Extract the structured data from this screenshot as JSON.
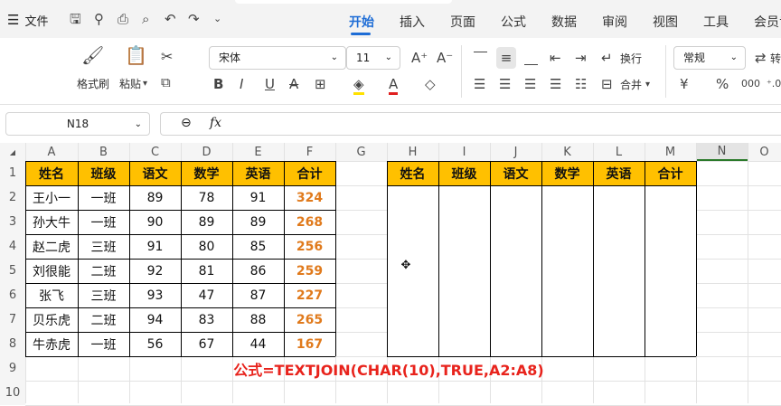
{
  "menu": {
    "file_label": "文件"
  },
  "tabs": [
    "开始",
    "插入",
    "页面",
    "公式",
    "数据",
    "审阅",
    "视图",
    "工具",
    "会员专"
  ],
  "ribbon": {
    "format_painter": "格式刷",
    "paste": "粘贴",
    "font_name": "宋体",
    "font_size": "11",
    "wrap_text": "换行",
    "merge": "合并",
    "number_format": "常规",
    "convert_label": "转"
  },
  "formula_bar": {
    "name_box": "N18",
    "fx": "fx",
    "content": ""
  },
  "columns": [
    "A",
    "B",
    "C",
    "D",
    "E",
    "F",
    "G",
    "H",
    "I",
    "J",
    "K",
    "L",
    "M",
    "N",
    "O"
  ],
  "rows": [
    "1",
    "2",
    "3",
    "4",
    "5",
    "6",
    "7",
    "8",
    "9",
    "10"
  ],
  "table_left": {
    "headers": [
      "姓名",
      "班级",
      "语文",
      "数学",
      "英语",
      "合计"
    ],
    "rows": [
      [
        "王小一",
        "一班",
        "89",
        "78",
        "91",
        "324"
      ],
      [
        "孙大牛",
        "一班",
        "90",
        "89",
        "89",
        "268"
      ],
      [
        "赵二虎",
        "三班",
        "91",
        "80",
        "85",
        "256"
      ],
      [
        "刘很能",
        "二班",
        "92",
        "81",
        "86",
        "259"
      ],
      [
        "张飞",
        "三班",
        "93",
        "47",
        "87",
        "227"
      ],
      [
        "贝乐虎",
        "二班",
        "94",
        "83",
        "88",
        "265"
      ],
      [
        "牛赤虎",
        "一班",
        "56",
        "67",
        "44",
        "167"
      ]
    ]
  },
  "table_right": {
    "headers": [
      "姓名",
      "班级",
      "语文",
      "数学",
      "英语",
      "合计"
    ]
  },
  "annotation": "公式=TEXTJOIN(CHAR(10),TRUE,A2:A8)",
  "colors": {
    "header_fill": "#ffc000",
    "sum_text": "#e07a1c",
    "annotation": "#e8231c",
    "active_tab": "#1e6dd6"
  }
}
